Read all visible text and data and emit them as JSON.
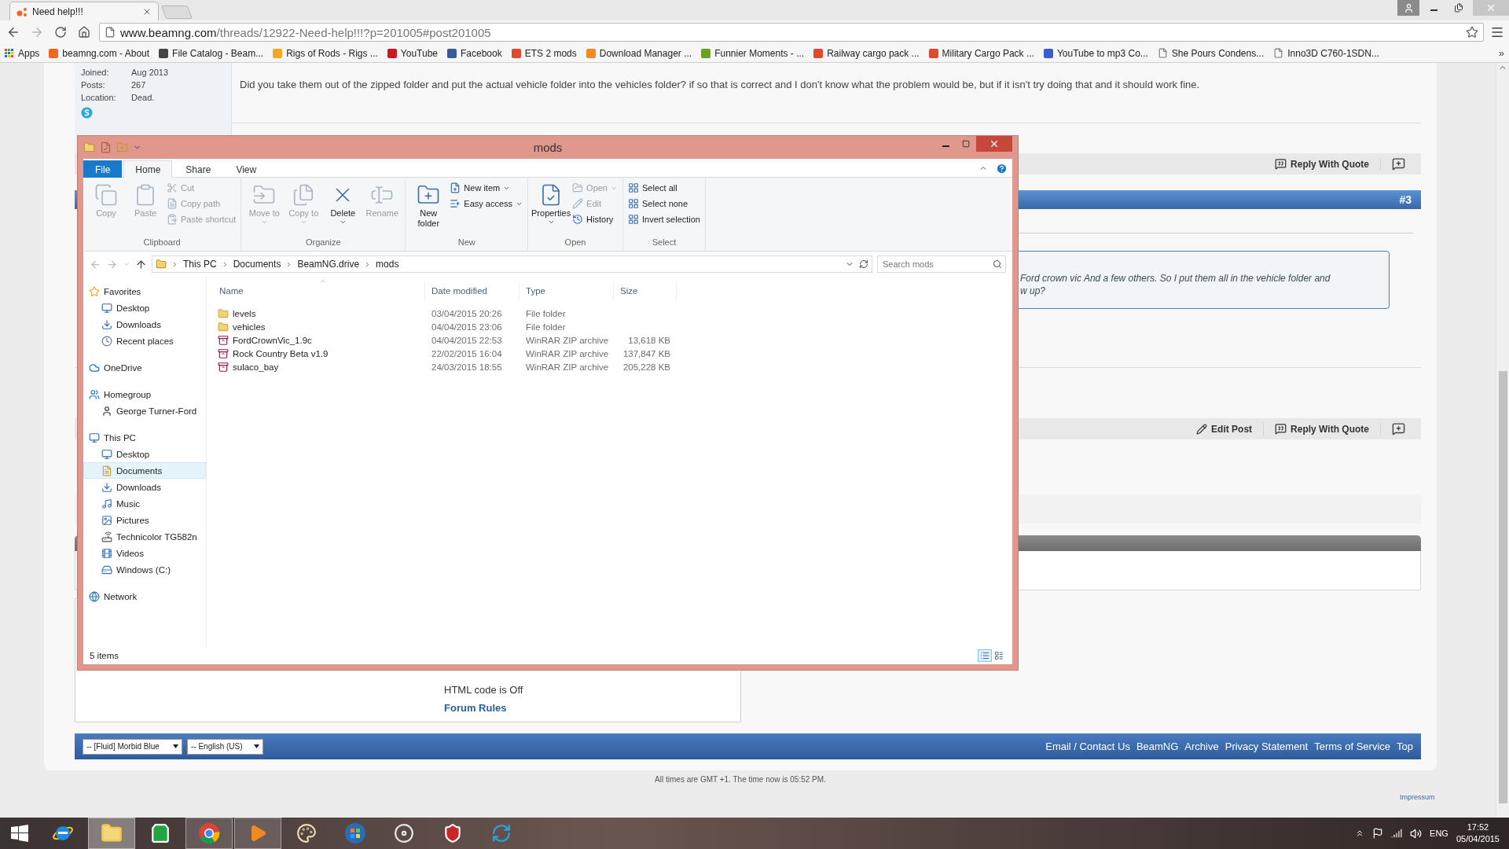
{
  "browser": {
    "tab": {
      "title": "Need help!!!"
    },
    "nav_buttons": [
      {
        "kind": "back",
        "disabled": false
      },
      {
        "kind": "forward",
        "disabled": true
      },
      {
        "kind": "reload",
        "disabled": false
      },
      {
        "kind": "home",
        "disabled": false
      }
    ],
    "url": {
      "host": "www.beamng.com",
      "path": "/threads/12922-Need-help!!!?p=201005#post201005"
    },
    "bookmarks": [
      {
        "label": "Apps",
        "kind": "apps"
      },
      {
        "label": "beamng.com - About",
        "kind": "site",
        "color": "#f26522"
      },
      {
        "label": "File Catalog - Beam...",
        "kind": "site",
        "color": "#444444"
      },
      {
        "label": "Rigs of Rods - Rigs ...",
        "kind": "site",
        "color": "#f5a623"
      },
      {
        "label": "YouTube",
        "kind": "site",
        "color": "#cc181e"
      },
      {
        "label": "Facebook",
        "kind": "site",
        "color": "#3b5998"
      },
      {
        "label": "ETS 2 mods",
        "kind": "site",
        "color": "#e04a2f"
      },
      {
        "label": "Download Manager ...",
        "kind": "site",
        "color": "#f08a24"
      },
      {
        "label": "Funnier Moments - ...",
        "kind": "site",
        "color": "#6aa121"
      },
      {
        "label": "Railway cargo pack ...",
        "kind": "site",
        "color": "#e04a2f"
      },
      {
        "label": "Military Cargo Pack ...",
        "kind": "site",
        "color": "#e04a2f"
      },
      {
        "label": "YouTube to mp3 Co...",
        "kind": "site",
        "color": "#3a5fcd"
      },
      {
        "label": "She Pours Condens...",
        "kind": "page"
      },
      {
        "label": "Inno3D C760-1SDN...",
        "kind": "page"
      }
    ],
    "more": "»"
  },
  "forum": {
    "post_2": {
      "user_info": [
        {
          "label": "Joined:",
          "value": "Aug 2013"
        },
        {
          "label": "Posts:",
          "value": "267"
        },
        {
          "label": "Location:",
          "value": "Dead."
        }
      ],
      "message": "Did you take them out of the zipped folder and put the actual vehicle folder into the vehicles folder? if so that is correct and I don't know what the problem would be, but if it isn't try doing that and it should work fine.",
      "actions": [
        {
          "kind": "quote",
          "label": "Reply With Quote"
        },
        {
          "kind": "multiquote"
        }
      ]
    },
    "post_3": {
      "number": "#3",
      "quote_lines": [
        "Ford crown vic And a few others. So I put them all in the vehicle folder and",
        "w up?"
      ],
      "actions": [
        {
          "kind": "edit",
          "label": "Edit Post"
        },
        {
          "kind": "quote",
          "label": "Reply With Quote"
        },
        {
          "kind": "multiquote"
        }
      ]
    },
    "rules": {
      "line": "HTML code is Off",
      "link": "Forum Rules"
    },
    "footer": {
      "selects": [
        "-- [Fluid] Morbid Blue",
        "-- English (US)"
      ],
      "links": [
        "Email / Contact Us",
        "BeamNG",
        "Archive",
        "Privacy Statement",
        "Terms of Service",
        "Top"
      ]
    },
    "time_note": "All times are GMT +1. The time now is 05:52 PM.",
    "impressum": "Impressum"
  },
  "explorer": {
    "title": "mods",
    "ribbon_tabs": [
      {
        "label": "File",
        "kind": "file",
        "selected": false
      },
      {
        "label": "Home",
        "kind": "tab",
        "selected": true
      },
      {
        "label": "Share",
        "kind": "tab",
        "selected": false
      },
      {
        "label": "View",
        "kind": "tab",
        "selected": false
      }
    ],
    "ribbon_groups": [
      {
        "label": "Clipboard",
        "items": [
          {
            "label": "Copy",
            "kind": "large",
            "disabled": true,
            "dropdown": false
          },
          {
            "label": "Paste",
            "kind": "large",
            "disabled": true,
            "dropdown": false
          },
          {
            "label": "Cut",
            "kind": "small",
            "disabled": true,
            "dropdown": false
          },
          {
            "label": "Copy path",
            "kind": "small",
            "disabled": true,
            "dropdown": false
          },
          {
            "label": "Paste shortcut",
            "kind": "small",
            "disabled": true,
            "dropdown": false
          }
        ]
      },
      {
        "label": "Organize",
        "items": [
          {
            "label": "Move to",
            "kind": "large",
            "disabled": true,
            "dropdown": true
          },
          {
            "label": "Copy to",
            "kind": "large",
            "disabled": true,
            "dropdown": true
          },
          {
            "label": "Delete",
            "kind": "large",
            "disabled": false,
            "dropdown": true
          },
          {
            "label": "Rename",
            "kind": "large",
            "disabled": true,
            "dropdown": false
          }
        ]
      },
      {
        "label": "New",
        "items": [
          {
            "label": "New folder",
            "kind": "large",
            "disabled": false,
            "dropdown": false
          },
          {
            "label": "New item",
            "kind": "small",
            "disabled": false,
            "dropdown": true
          },
          {
            "label": "Easy access",
            "kind": "small",
            "disabled": false,
            "dropdown": true
          }
        ]
      },
      {
        "label": "Open",
        "items": [
          {
            "label": "Properties",
            "kind": "large",
            "disabled": false,
            "dropdown": true
          },
          {
            "label": "Open",
            "kind": "small",
            "disabled": true,
            "dropdown": true
          },
          {
            "label": "Edit",
            "kind": "small",
            "disabled": true,
            "dropdown": false
          },
          {
            "label": "History",
            "kind": "small",
            "disabled": false,
            "dropdown": false
          }
        ]
      },
      {
        "label": "Select",
        "items": [
          {
            "label": "Select all",
            "kind": "small",
            "disabled": false,
            "dropdown": false
          },
          {
            "label": "Select none",
            "kind": "small",
            "disabled": false,
            "dropdown": false
          },
          {
            "label": "Invert selection",
            "kind": "small",
            "disabled": false,
            "dropdown": false
          }
        ]
      }
    ],
    "breadcrumbs": [
      "This PC",
      "Documents",
      "BeamNG.drive",
      "mods"
    ],
    "search": {
      "placeholder": "Search mods"
    },
    "nav_tree": [
      {
        "label": "Favorites",
        "kind": "favorites",
        "selected": false,
        "children": [
          {
            "label": "Desktop",
            "kind": "desktop",
            "selected": false
          },
          {
            "label": "Downloads",
            "kind": "downloads",
            "selected": false
          },
          {
            "label": "Recent places",
            "kind": "recent",
            "selected": false
          }
        ]
      },
      {
        "label": "OneDrive",
        "kind": "cloud",
        "selected": false
      },
      {
        "label": "Homegroup",
        "kind": "homegroup",
        "selected": false,
        "children": [
          {
            "label": "George Turner-Ford",
            "kind": "user",
            "selected": false
          }
        ]
      },
      {
        "label": "This PC",
        "kind": "pc",
        "selected": false,
        "children": [
          {
            "label": "Desktop",
            "kind": "desktop",
            "selected": false
          },
          {
            "label": "Documents",
            "kind": "documents",
            "selected": true
          },
          {
            "label": "Downloads",
            "kind": "downloads",
            "selected": false
          },
          {
            "label": "Music",
            "kind": "music",
            "selected": false
          },
          {
            "label": "Pictures",
            "kind": "pictures",
            "selected": false
          },
          {
            "label": "Technicolor TG582n",
            "kind": "router",
            "selected": false
          },
          {
            "label": "Videos",
            "kind": "videos",
            "selected": false
          },
          {
            "label": "Windows (C:)",
            "kind": "drive",
            "selected": false
          }
        ]
      },
      {
        "label": "Network",
        "kind": "network",
        "selected": false
      }
    ],
    "columns": [
      {
        "label": "Name",
        "sorted": true
      },
      {
        "label": "Date modified",
        "sorted": false
      },
      {
        "label": "Type",
        "sorted": false
      },
      {
        "label": "Size",
        "sorted": false
      }
    ],
    "files": [
      {
        "name": "levels",
        "date": "03/04/2015 20:26",
        "type": "File folder",
        "kind": "folder"
      },
      {
        "name": "vehicles",
        "date": "04/04/2015 23:06",
        "type": "File folder",
        "kind": "folder"
      },
      {
        "name": "FordCrownVic_1.9c",
        "date": "04/04/2015 22:53",
        "type": "WinRAR ZIP archive",
        "size": "13,618 KB",
        "kind": "archive"
      },
      {
        "name": "Rock Country Beta v1.9",
        "date": "22/02/2015 16:04",
        "type": "WinRAR ZIP archive",
        "size": "137,847 KB",
        "kind": "archive"
      },
      {
        "name": "sulaco_bay",
        "date": "24/03/2015 18:55",
        "type": "WinRAR ZIP archive",
        "size": "205,228 KB",
        "kind": "archive"
      }
    ],
    "status": "5 items",
    "views": [
      {
        "kind": "details",
        "selected": true
      },
      {
        "kind": "tiles",
        "selected": false
      }
    ]
  },
  "taskbar": {
    "apps": [
      {
        "kind": "ie",
        "active": false,
        "open": false
      },
      {
        "kind": "explorer",
        "active": true,
        "open": true
      },
      {
        "kind": "store",
        "active": false,
        "open": false
      },
      {
        "kind": "chrome",
        "active": false,
        "open": true
      },
      {
        "kind": "media",
        "active": false,
        "open": true
      },
      {
        "kind": "paint",
        "active": false,
        "open": false
      },
      {
        "kind": "orb",
        "active": false,
        "open": false
      },
      {
        "kind": "steam",
        "active": false,
        "open": false
      },
      {
        "kind": "badge",
        "active": false,
        "open": false
      },
      {
        "kind": "refresh",
        "active": false,
        "open": false
      }
    ],
    "language": "ENG",
    "time": "17:52",
    "date": "05/04/2015"
  }
}
